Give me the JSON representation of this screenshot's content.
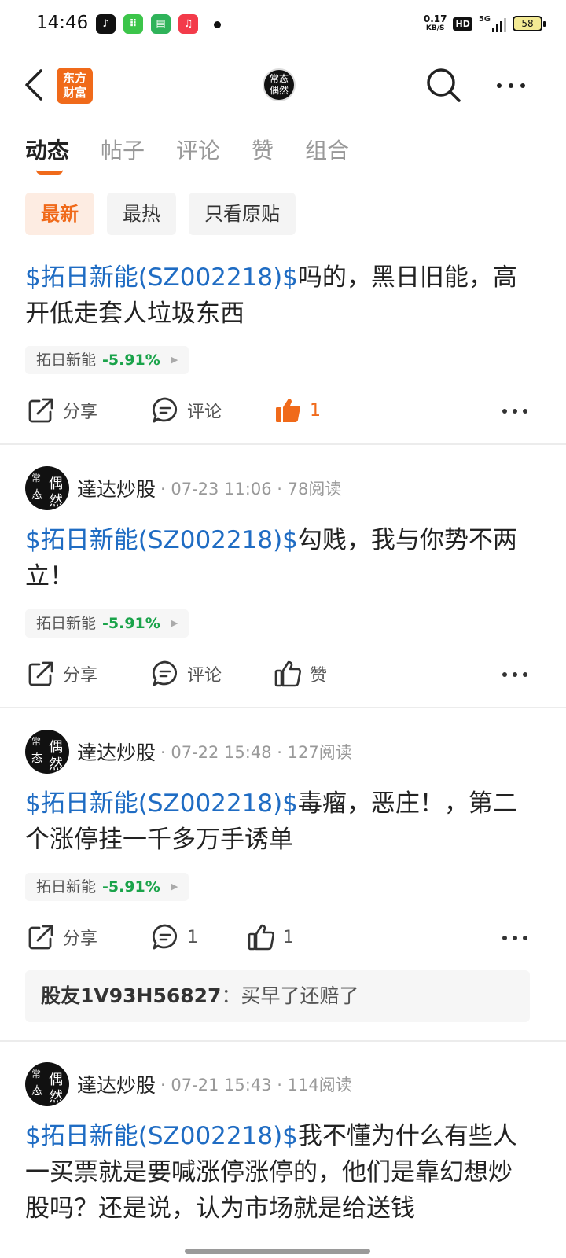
{
  "status_bar": {
    "time": "14:46",
    "speed_value": "0.17",
    "speed_unit": "KB/S",
    "hd": "HD",
    "network": "5G",
    "battery": "58"
  },
  "header": {
    "brand_line1": "东方",
    "brand_line2": "财富",
    "avatar_text": "常态偶然",
    "accent_color": "#f06a1a"
  },
  "tabs": [
    {
      "label": "动态",
      "active": true
    },
    {
      "label": "帖子",
      "active": false
    },
    {
      "label": "评论",
      "active": false
    },
    {
      "label": "赞",
      "active": false
    },
    {
      "label": "组合",
      "active": false
    }
  ],
  "filters": [
    {
      "label": "最新",
      "active": true
    },
    {
      "label": "最热",
      "active": false
    },
    {
      "label": "只看原贴",
      "active": false
    }
  ],
  "posts": [
    {
      "author": "",
      "meta": "",
      "stock_link": "$拓日新能(SZ002218)$",
      "text": "吗的，黑日旧能，高开低走套人垃圾东西",
      "stock_name": "拓日新能",
      "stock_change": "-5.91%",
      "share_label": "分享",
      "comment_label": "评论",
      "like_label": "1",
      "liked": true
    },
    {
      "author": "達达炒股",
      "meta": "· 07-23 11:06 · 78阅读",
      "stock_link": "$拓日新能(SZ002218)$",
      "text": "勾贱，我与你势不两立！",
      "stock_name": "拓日新能",
      "stock_change": "-5.91%",
      "share_label": "分享",
      "comment_label": "评论",
      "like_label": "赞",
      "liked": false
    },
    {
      "author": "達达炒股",
      "meta": "· 07-22 15:48 · 127阅读",
      "stock_link": "$拓日新能(SZ002218)$",
      "text": "毒瘤，恶庄！，第二个涨停挂一千多万手诱单",
      "stock_name": "拓日新能",
      "stock_change": "-5.91%",
      "share_label": "分享",
      "comment_label": "1",
      "like_label": "1",
      "liked": false,
      "comment_author": "股友1V93H56827",
      "comment_text": "：买早了还赔了"
    },
    {
      "author": "達达炒股",
      "meta": "· 07-21 15:43 · 114阅读",
      "stock_link": "$拓日新能(SZ002218)$",
      "text": "我不懂为什么有些人一买票就是要喊涨停涨停的，他们是靠幻想炒股吗？还是说，认为市场就是给送钱"
    }
  ]
}
